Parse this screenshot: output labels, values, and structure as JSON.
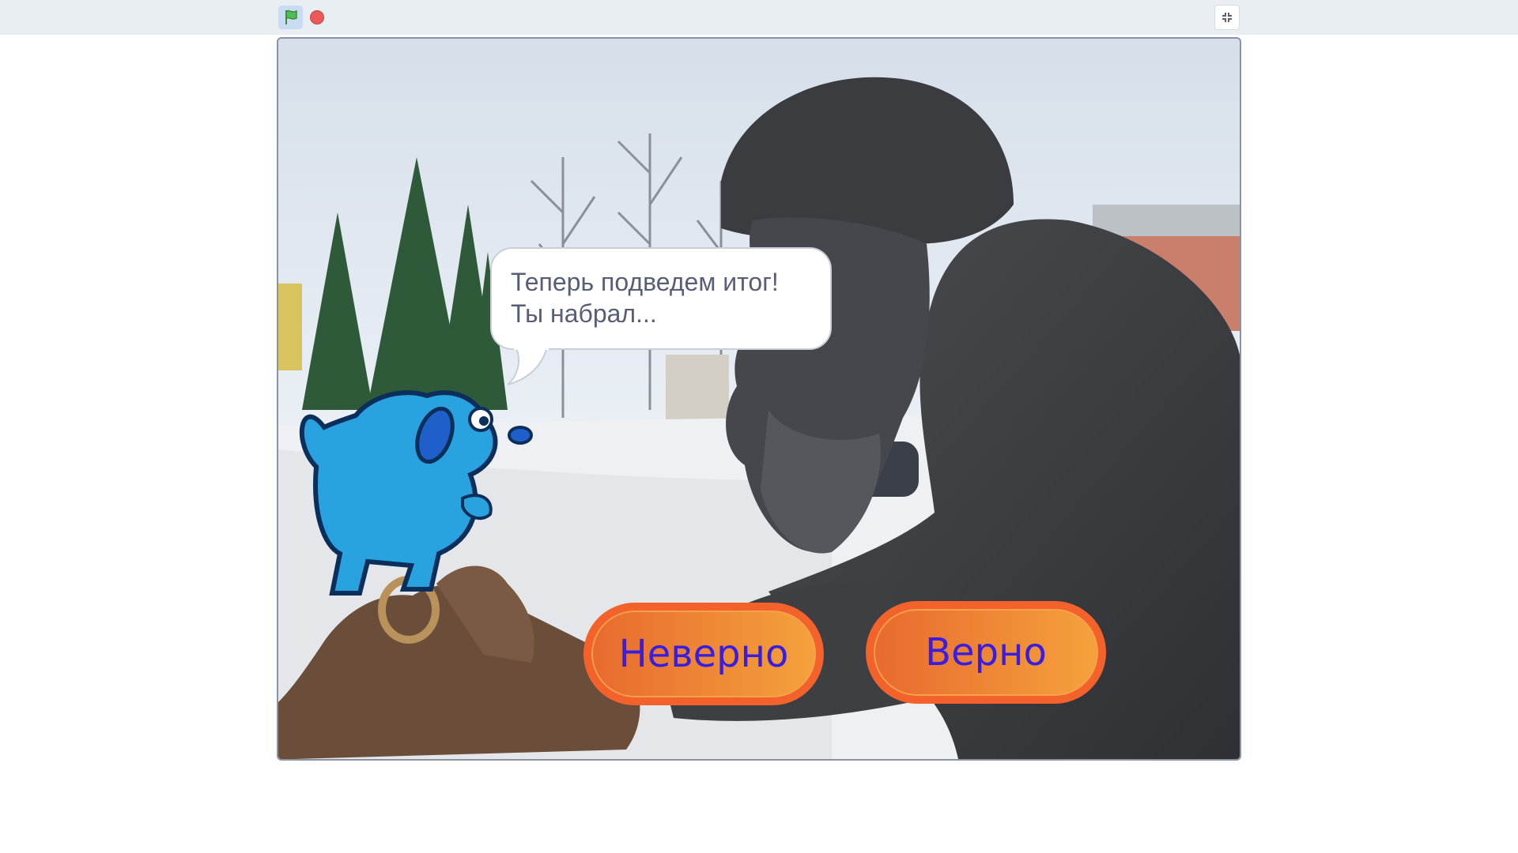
{
  "toolbar": {
    "green_flag_icon": "green-flag-icon",
    "stop_icon": "stop-sign-icon",
    "fullscreen_icon": "exit-fullscreen-icon"
  },
  "stage": {
    "speech_bubble": {
      "line1": "Теперь подведем итог!",
      "line2": "Ты набрал..."
    },
    "buttons": {
      "wrong_label": "Неверно",
      "right_label": "Верно"
    },
    "colors": {
      "button_fill_start": "#e86a2f",
      "button_fill_end": "#f4a23c",
      "button_text": "#3a1ee0",
      "dog_body": "#29a3e0"
    }
  }
}
